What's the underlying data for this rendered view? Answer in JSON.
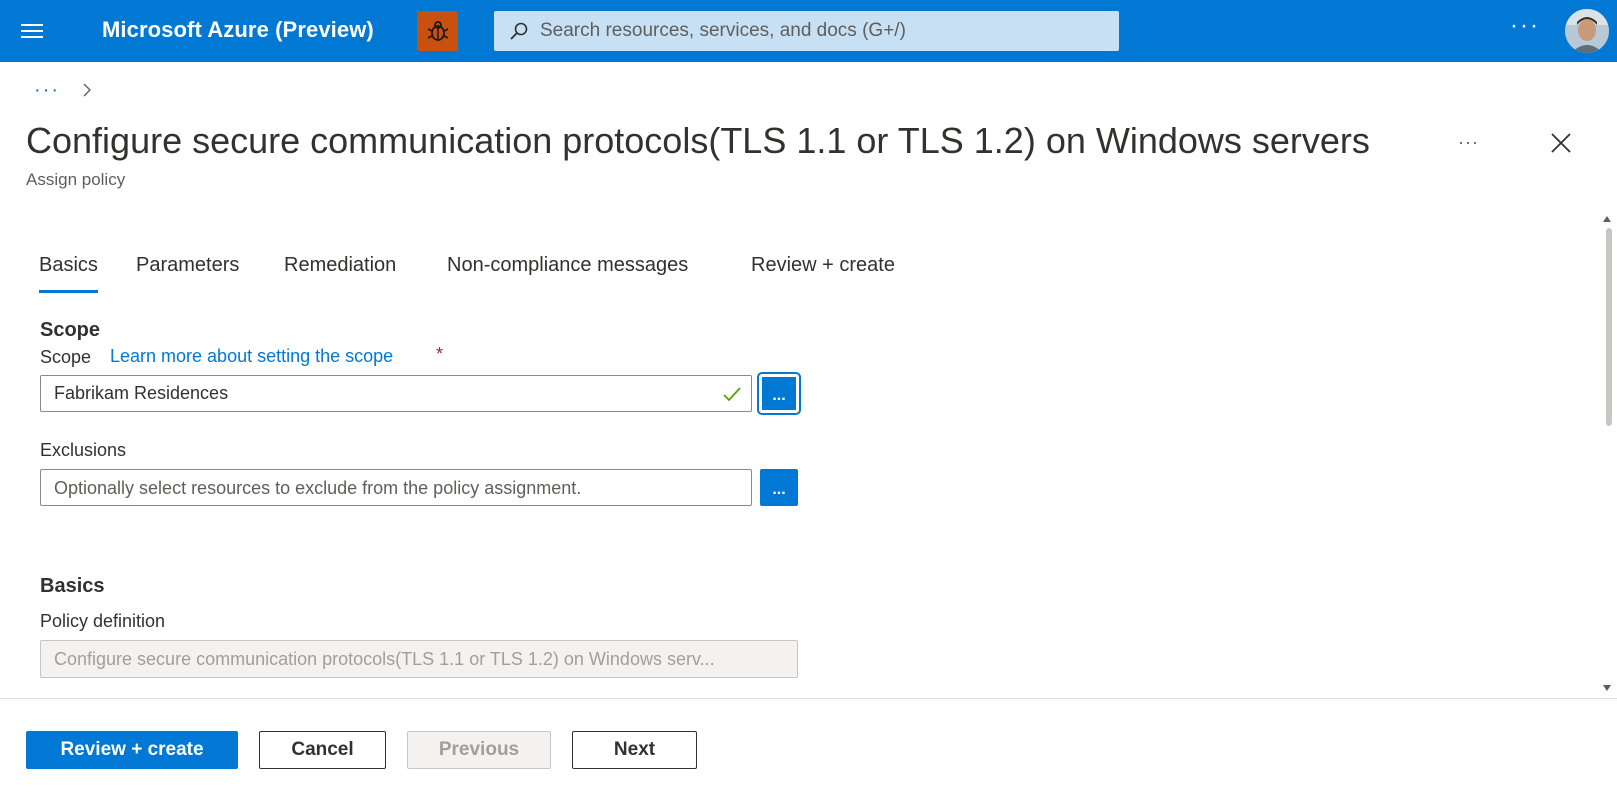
{
  "topbar": {
    "brand": "Microsoft Azure (Preview)",
    "search_placeholder": "Search resources, services, and docs (G+/)",
    "more": "···",
    "colors": {
      "background": "#0078d4",
      "bug_button": "#ca5010",
      "search_bg": "#c7e0f4"
    }
  },
  "breadcrumb": {
    "more": "···"
  },
  "header": {
    "title": "Configure secure communication protocols(TLS 1.1 or TLS 1.2) on Windows servers",
    "subtitle": "Assign policy",
    "more": "···"
  },
  "tabs": [
    {
      "label": "Basics",
      "active": true
    },
    {
      "label": "Parameters",
      "active": false
    },
    {
      "label": "Remediation",
      "active": false
    },
    {
      "label": "Non-compliance messages",
      "active": false
    },
    {
      "label": "Review + create",
      "active": false
    }
  ],
  "scope_section": {
    "header": "Scope",
    "label": "Scope",
    "learn_more": "Learn more about setting the scope",
    "required_marker": "*",
    "value": "Fabrikam Residences",
    "browse_button": "..."
  },
  "exclusions": {
    "label": "Exclusions",
    "placeholder": "Optionally select resources to exclude from the policy assignment.",
    "browse_button": "..."
  },
  "basics_section": {
    "header": "Basics",
    "policy_definition_label": "Policy definition",
    "policy_definition_value": "Configure secure communication protocols(TLS 1.1 or TLS 1.2) on Windows serv..."
  },
  "footer": {
    "review_create": "Review + create",
    "cancel": "Cancel",
    "previous": "Previous",
    "next": "Next"
  }
}
